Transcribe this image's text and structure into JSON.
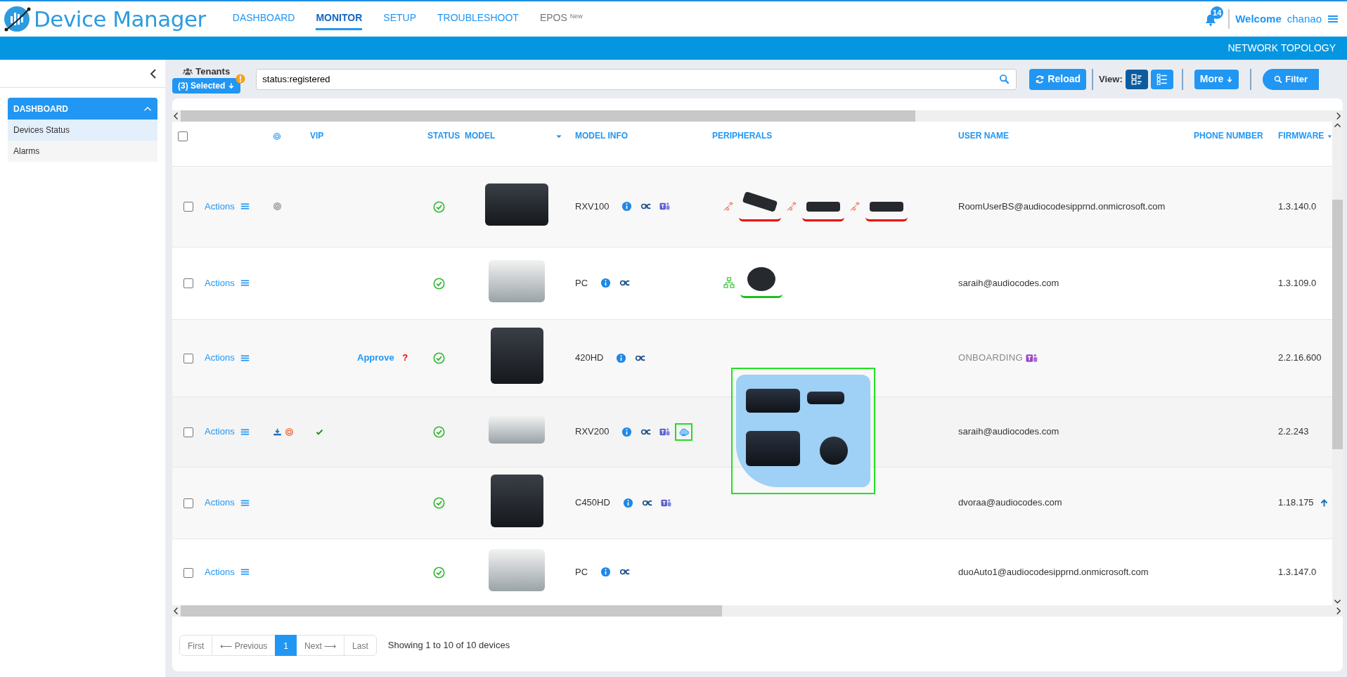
{
  "header": {
    "app_title": "Device Manager",
    "nav": [
      {
        "label": "DASHBOARD",
        "selected": false
      },
      {
        "label": "MONITOR",
        "selected": true
      },
      {
        "label": "SETUP",
        "selected": false
      },
      {
        "label": "TROUBLESHOOT",
        "selected": false
      },
      {
        "label": "EPOS",
        "sup": "New",
        "selected": false
      }
    ],
    "notifications": "14",
    "welcome": "Welcome",
    "user": "chanao"
  },
  "subbar": {
    "link": "NETWORK TOPOLOGY"
  },
  "sidebar": {
    "section": "DASHBOARD",
    "expanded": true,
    "items": [
      {
        "label": "Devices Status",
        "selected": true
      },
      {
        "label": "Alarms",
        "selected": false
      }
    ]
  },
  "toolbar": {
    "tenants_label": "Tenants",
    "tenants_button": "(3) Selected",
    "tenants_warning": true,
    "search_value": "status:registered",
    "reload": "Reload",
    "view_label": "View:",
    "views": [
      {
        "selected": true
      },
      {
        "selected": false
      }
    ],
    "more": "More",
    "filter": "Filter"
  },
  "table": {
    "select_all_checked": false,
    "columns": {
      "vip": "VIP",
      "status": "STATUS",
      "model": "MODEL",
      "model_info": "MODEL INFO",
      "peripherals": "PERIPHERALS",
      "user_name": "USER NAME",
      "phone_number": "PHONE NUMBER",
      "firmware": "FIRMWARE"
    },
    "rows": [
      {
        "checked": false,
        "actions": "Actions",
        "markers": [
          {
            "kind": "target-grey"
          }
        ],
        "vip": false,
        "status_ok": true,
        "model_info": "RXV100",
        "info_icons": [
          {
            "kind": "info",
            "highlighted": false
          },
          {
            "kind": "logo",
            "highlighted": false
          },
          {
            "kind": "collab",
            "highlighted": false
          }
        ],
        "peripherals": [
          {
            "kind": "soundbar",
            "connected": false
          },
          {
            "kind": "camera",
            "connected": false
          },
          {
            "kind": "camera",
            "connected": false
          }
        ],
        "user_name": "RoomUserBS@audiocodesipprnd.onmicrosoft.com",
        "user_onboarding": false,
        "firmware": "1.3.140.0",
        "upgrade": false
      },
      {
        "checked": false,
        "actions": "Actions",
        "markers": [],
        "vip": false,
        "status_ok": true,
        "model_info": "PC",
        "info_icons": [
          {
            "kind": "info",
            "highlighted": false
          },
          {
            "kind": "logo",
            "highlighted": false
          }
        ],
        "peripherals": [
          {
            "kind": "speaker",
            "connected": true
          }
        ],
        "user_name": "saraih@audiocodes.com",
        "user_onboarding": false,
        "firmware": "1.3.109.0",
        "upgrade": false
      },
      {
        "checked": false,
        "actions": "Actions",
        "markers": [],
        "vip": false,
        "approve": "Approve",
        "approve_hint": "?",
        "status_ok": true,
        "model_info": "420HD",
        "info_icons": [
          {
            "kind": "info",
            "highlighted": false
          },
          {
            "kind": "logo",
            "highlighted": false
          }
        ],
        "user_name": "ONBOARDING",
        "user_onboarding": true,
        "firmware": "2.2.16.600",
        "upgrade": false
      },
      {
        "checked": false,
        "actions": "Actions",
        "markers": [
          {
            "kind": "download"
          },
          {
            "kind": "target-orange"
          }
        ],
        "vip": true,
        "status_ok": true,
        "model_info": "RXV200",
        "info_icons": [
          {
            "kind": "info",
            "highlighted": false
          },
          {
            "kind": "logo",
            "highlighted": false
          },
          {
            "kind": "collab",
            "highlighted": false
          },
          {
            "kind": "cloud",
            "highlighted": true
          }
        ],
        "popup": [
          {
            "kind": "hub"
          },
          {
            "kind": "camera"
          },
          {
            "kind": "tablet"
          },
          {
            "kind": "speaker"
          }
        ],
        "user_name": "saraih@audiocodes.com",
        "user_onboarding": false,
        "firmware": "2.2.243",
        "upgrade": false
      },
      {
        "checked": false,
        "actions": "Actions",
        "markers": [],
        "vip": false,
        "status_ok": true,
        "model_info": "C450HD",
        "info_icons": [
          {
            "kind": "info",
            "highlighted": false
          },
          {
            "kind": "logo",
            "highlighted": false
          },
          {
            "kind": "collab",
            "highlighted": false
          }
        ],
        "user_name": "dvoraa@audiocodes.com",
        "user_onboarding": false,
        "firmware": "1.18.175",
        "upgrade": true
      },
      {
        "checked": false,
        "actions": "Actions",
        "markers": [],
        "vip": false,
        "status_ok": true,
        "model_info": "PC",
        "info_icons": [
          {
            "kind": "info",
            "highlighted": false
          },
          {
            "kind": "logo",
            "highlighted": false
          }
        ],
        "user_name": "duoAuto1@audiocodesipprnd.onmicrosoft.com",
        "user_onboarding": false,
        "firmware": "1.3.147.0",
        "upgrade": false
      }
    ]
  },
  "pagination": {
    "pages": [
      {
        "label": "First",
        "selected": false
      },
      {
        "label": "⟵ Previous",
        "selected": false
      },
      {
        "label": "1",
        "selected": true
      },
      {
        "label": "Next ⟶",
        "selected": false
      },
      {
        "label": "Last",
        "selected": false
      }
    ],
    "summary": "Showing 1 to 10 of 10 devices"
  }
}
